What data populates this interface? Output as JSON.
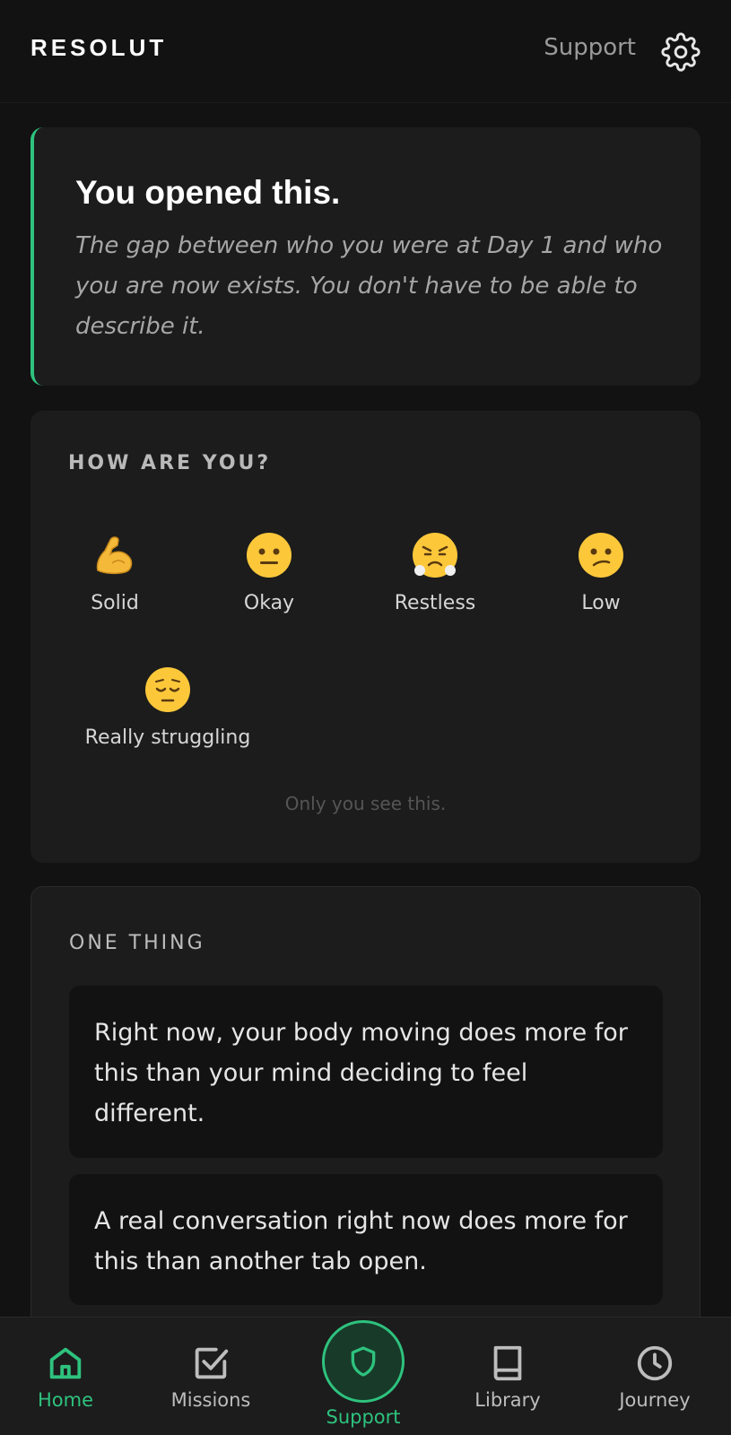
{
  "header": {
    "brand": "RESOLUT",
    "support_link": "Support",
    "settings_icon": "gear-icon"
  },
  "intro": {
    "title": "You opened this.",
    "body": "The gap between who you were at Day 1 and who you are now exists. You don't have to be able to describe it."
  },
  "mood": {
    "heading": "HOW ARE YOU?",
    "options": [
      {
        "emoji": "flexed-biceps-emoji",
        "label": "Solid"
      },
      {
        "emoji": "neutral-face-emoji",
        "label": "Okay"
      },
      {
        "emoji": "steaming-face-emoji",
        "label": "Restless"
      },
      {
        "emoji": "confused-face-emoji",
        "label": "Low"
      },
      {
        "emoji": "pensive-face-emoji",
        "label": "Really struggling"
      }
    ],
    "privacy_note": "Only you see this."
  },
  "one_thing": {
    "heading": "ONE THING",
    "tips": [
      "Right now, your body moving does more for this than your mind deciding to feel different.",
      "A real conversation right now does more for this than another tab open."
    ]
  },
  "nav": {
    "items": [
      {
        "label": "Home",
        "icon": "home-icon",
        "active": true
      },
      {
        "label": "Missions",
        "icon": "checkbox-icon",
        "active": false
      },
      {
        "label": "Support",
        "icon": "shield-icon",
        "active": false
      },
      {
        "label": "Library",
        "icon": "book-icon",
        "active": false
      },
      {
        "label": "Journey",
        "icon": "clock-icon",
        "active": false
      }
    ]
  },
  "colors": {
    "accent": "#2ec27e",
    "background": "#121212",
    "card": "#1c1c1c"
  }
}
